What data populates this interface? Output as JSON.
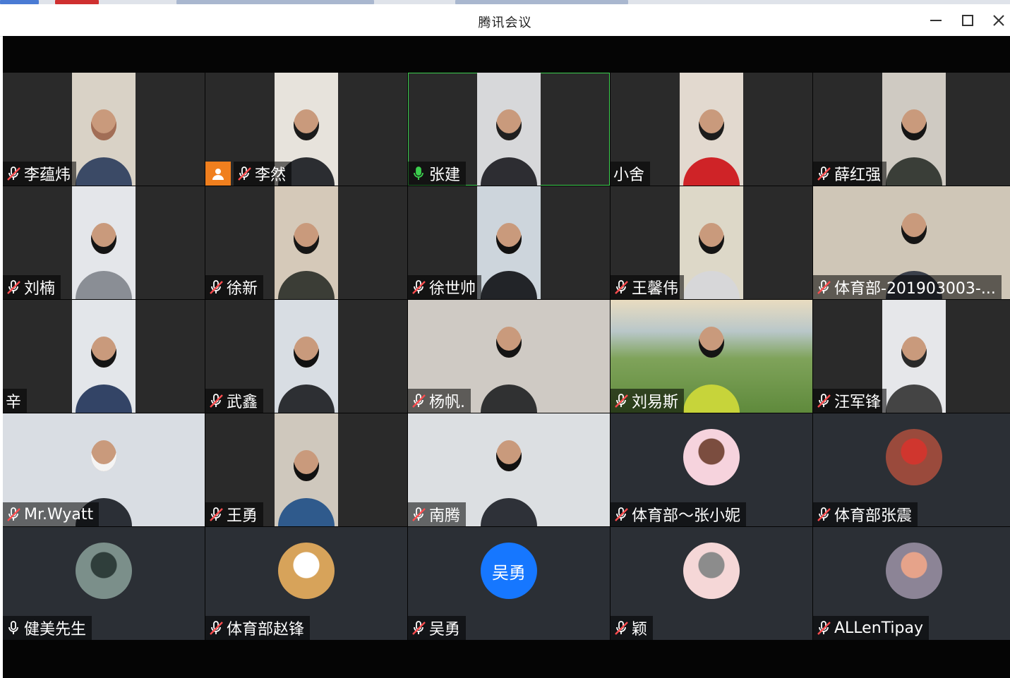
{
  "window": {
    "title": "腾讯会议",
    "controls": {
      "minimize": "minimize-icon",
      "maximize": "maximize-icon",
      "close": "close-icon"
    }
  },
  "colors": {
    "active_speaker": "#3ccf4e",
    "host_badge": "#f07f1e",
    "initials_bg": "#1677ff",
    "mic_active": "#3ccf4e"
  },
  "participants": [
    {
      "name": "李蕴炜",
      "mic": "muted",
      "kind": "video",
      "bg": "#d9d2c6",
      "shirt": "#3b4a66",
      "hair": "#a26e56"
    },
    {
      "name": "李然",
      "mic": "muted",
      "kind": "video",
      "bg": "#e7e3dc",
      "shirt": "#2b2d31",
      "hair": "#1b1b1b",
      "host": true
    },
    {
      "name": "张建",
      "mic": "speaking",
      "kind": "video",
      "bg": "#d7d8da",
      "shirt": "#2d2d32",
      "hair": "#202020",
      "active": true
    },
    {
      "name": "小舍",
      "mic": "none",
      "kind": "video",
      "bg": "#e2d9cf",
      "shirt": "#cf2327",
      "hair": "#1c1c1c"
    },
    {
      "name": "薛红强",
      "mic": "muted",
      "kind": "video",
      "bg": "#cfcac2",
      "shirt": "#3a3e38",
      "hair": "#151515"
    },
    {
      "name": "刘楠",
      "mic": "muted",
      "kind": "video",
      "bg": "#e4e6ea",
      "shirt": "#8a8e95",
      "hair": "#141414"
    },
    {
      "name": "徐新",
      "mic": "muted",
      "kind": "video",
      "bg": "#d5c9b9",
      "shirt": "#3b3d36",
      "hair": "#161616"
    },
    {
      "name": "徐世帅",
      "mic": "muted",
      "kind": "video",
      "bg": "#cdd5dc",
      "shirt": "#222428",
      "hair": "#111111"
    },
    {
      "name": "王馨伟",
      "mic": "muted",
      "kind": "video",
      "bg": "#ddd8c8",
      "shirt": "#d7d7d9",
      "hair": "#141414"
    },
    {
      "name": "体育部-201903003-...",
      "mic": "muted",
      "kind": "video",
      "bg": "#cfc6b7",
      "shirt": "#3a3f4a",
      "hair": "#161616",
      "full": true
    },
    {
      "name": "辛",
      "mic": "none",
      "kind": "video",
      "bg": "#e3e6ea",
      "shirt": "#334466",
      "hair": "#151515"
    },
    {
      "name": "武鑫",
      "mic": "muted",
      "kind": "video",
      "bg": "#d8dde3",
      "shirt": "#2d2f33",
      "hair": "#111111"
    },
    {
      "name": "杨帆.",
      "mic": "muted",
      "kind": "video",
      "bg": "#cfcac4",
      "shirt": "#303132",
      "hair": "#141414",
      "full": true
    },
    {
      "name": "刘易斯",
      "mic": "muted",
      "kind": "video",
      "bg": "#8aa463",
      "shirt": "#c7d43a",
      "hair": "#141414",
      "full": true,
      "landscape": true
    },
    {
      "name": "汪军锋",
      "mic": "muted",
      "kind": "video",
      "bg": "#e6e7ea",
      "shirt": "#444444",
      "hair": "#2a2a2a"
    },
    {
      "name": "Mr.Wyatt",
      "mic": "muted",
      "kind": "video",
      "bg": "#d9dde3",
      "shirt": "#2b2f36",
      "hair": "#f4f4f4",
      "full": true
    },
    {
      "name": "王勇",
      "mic": "muted",
      "kind": "video",
      "bg": "#cfc8bd",
      "shirt": "#2f5a8c",
      "hair": "#111111"
    },
    {
      "name": "南腾",
      "mic": "muted",
      "kind": "video",
      "bg": "#dcdfe2",
      "shirt": "#2e3138",
      "hair": "#111111",
      "full": true
    },
    {
      "name": "体育部～张小妮",
      "mic": "muted",
      "kind": "avatar",
      "avatar_bg": "#f6d3dd",
      "avatar_fg": "#7b4d3f"
    },
    {
      "name": "体育部张震",
      "mic": "muted",
      "kind": "avatar",
      "avatar_bg": "#9a4a3c",
      "avatar_fg": "#d0362e"
    },
    {
      "name": "健美先生",
      "mic": "unmuted",
      "kind": "avatar",
      "avatar_bg": "#7b8f8a",
      "avatar_fg": "#2f3e3b"
    },
    {
      "name": "体育部赵锋",
      "mic": "muted",
      "kind": "avatar",
      "avatar_bg": "#d7a35a",
      "avatar_fg": "#ffffff"
    },
    {
      "name": "吴勇",
      "mic": "muted",
      "kind": "initials",
      "initials": "吴勇"
    },
    {
      "name": "颖",
      "mic": "muted",
      "kind": "avatar",
      "avatar_bg": "#f5d7d7",
      "avatar_fg": "#8c8c8c"
    },
    {
      "name": "ALLenTipay",
      "mic": "muted",
      "kind": "avatar",
      "avatar_bg": "#8c8496",
      "avatar_fg": "#e6a38a"
    }
  ]
}
